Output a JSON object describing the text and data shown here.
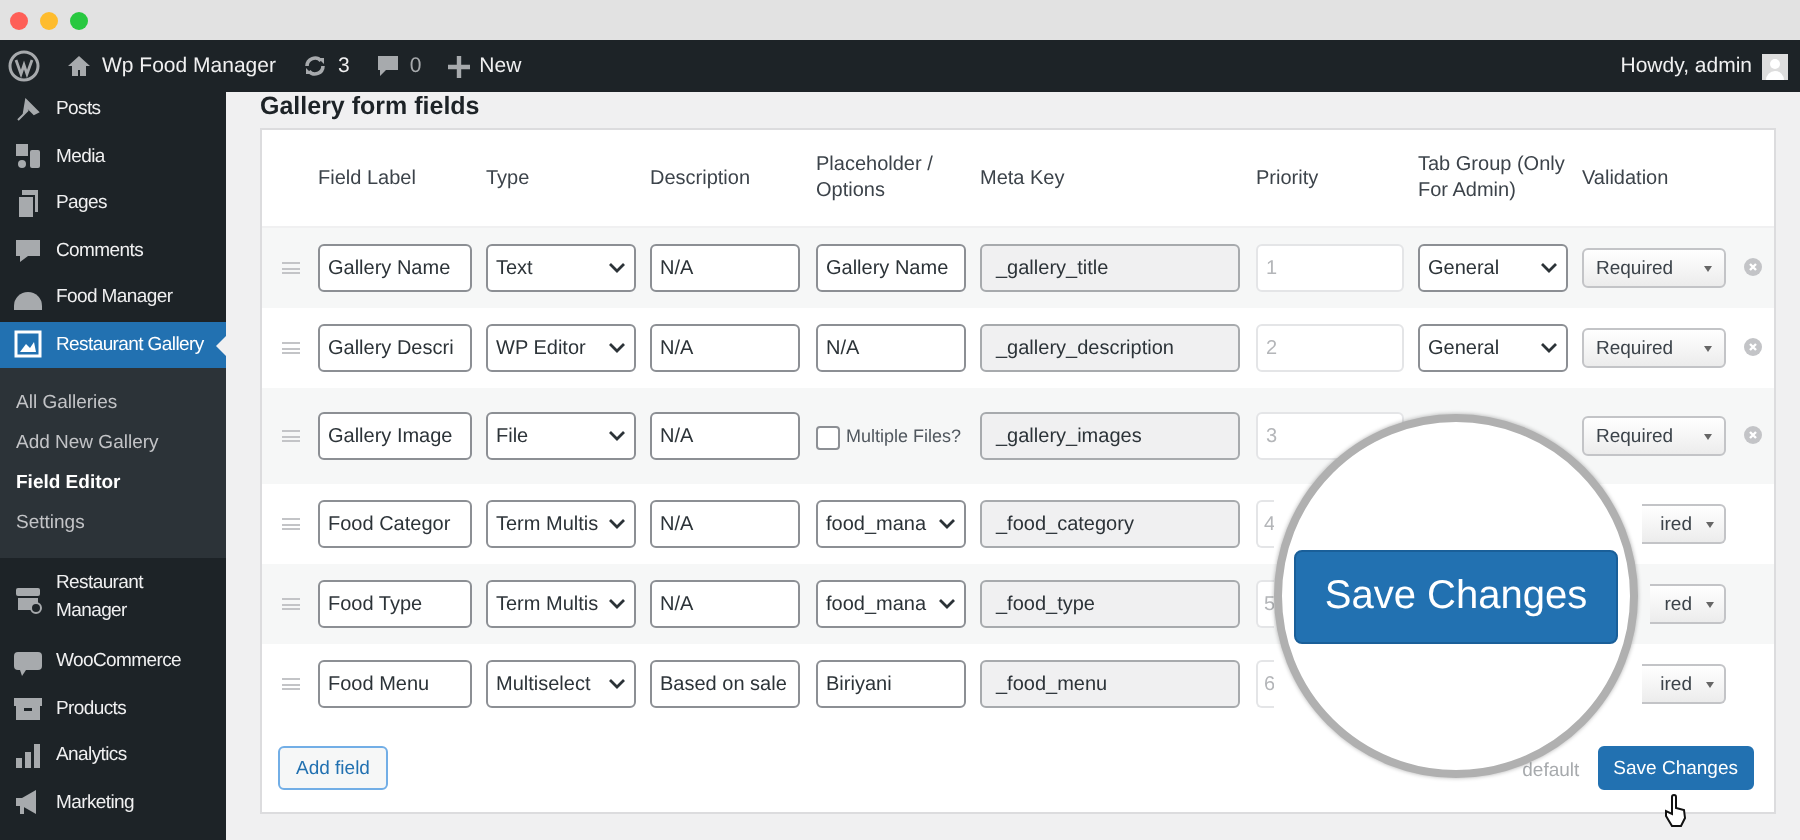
{
  "admin_bar": {
    "site": "Wp Food Manager",
    "updates": "3",
    "comments": "0",
    "new": "New",
    "greeting": "Howdy, admin"
  },
  "sidebar": {
    "items": [
      {
        "label": "Posts",
        "selected": false
      },
      {
        "label": "Media",
        "selected": false
      },
      {
        "label": "Pages",
        "selected": false
      },
      {
        "label": "Comments",
        "selected": false
      },
      {
        "label": "Food Manager",
        "selected": false
      },
      {
        "label": "Restaurant Gallery",
        "selected": true,
        "children": [
          {
            "label": "All Galleries",
            "selected": false
          },
          {
            "label": "Add New Gallery",
            "selected": false
          },
          {
            "label": "Field Editor",
            "selected": true
          },
          {
            "label": "Settings",
            "selected": false
          }
        ]
      },
      {
        "label": "Restaurant Manager",
        "selected": false
      },
      {
        "label": "WooCommerce",
        "selected": false
      },
      {
        "label": "Products",
        "selected": false
      },
      {
        "label": "Analytics",
        "selected": false
      },
      {
        "label": "Marketing",
        "selected": false
      }
    ]
  },
  "section_title": "Gallery form fields",
  "table": {
    "columns": [
      "Field Label",
      "Type",
      "Description",
      "Placeholder / Options",
      "Meta Key",
      "Priority",
      "Tab Group (Only For Admin)",
      "Validation"
    ],
    "rows": [
      {
        "label": "Gallery Name",
        "type": "Text",
        "description": "N/A",
        "options": {
          "kind": "text",
          "value": "Gallery Name"
        },
        "meta_key": "_gallery_title",
        "priority": "1",
        "tab_group": "General",
        "validation": "Required",
        "removable": true
      },
      {
        "label": "Gallery Descri",
        "type": "WP Editor",
        "description": "N/A",
        "options": {
          "kind": "text",
          "value": "N/A"
        },
        "meta_key": "_gallery_description",
        "priority": "2",
        "tab_group": "General",
        "validation": "Required",
        "removable": true
      },
      {
        "label": "Gallery Image",
        "type": "File",
        "description": "N/A",
        "options": {
          "kind": "checkbox",
          "label": "Multiple Files?",
          "checked": false
        },
        "meta_key": "_gallery_images",
        "priority": "3",
        "validation": "Required",
        "removable": true
      },
      {
        "label": "Food Categor",
        "type": "Term Multis",
        "description": "N/A",
        "options": {
          "kind": "select",
          "value": "food_mana"
        },
        "meta_key": "_food_category",
        "priority": "4",
        "validation": "ired",
        "removable": false
      },
      {
        "label": "Food Type",
        "type": "Term Multis",
        "description": "N/A",
        "options": {
          "kind": "select",
          "value": "food_mana"
        },
        "meta_key": "_food_type",
        "priority": "5",
        "validation": "red",
        "removable": false
      },
      {
        "label": "Food Menu",
        "type": "Multiselect",
        "description": "Based on sale",
        "options": {
          "kind": "text",
          "value": "Biriyani"
        },
        "meta_key": "_food_menu",
        "priority": "6",
        "validation": "ired",
        "removable": false
      }
    ]
  },
  "footer": {
    "add_button": "Add field",
    "reset_link": "default",
    "save_button": "Save Changes"
  },
  "magnifier": {
    "button": "Save Changes"
  }
}
